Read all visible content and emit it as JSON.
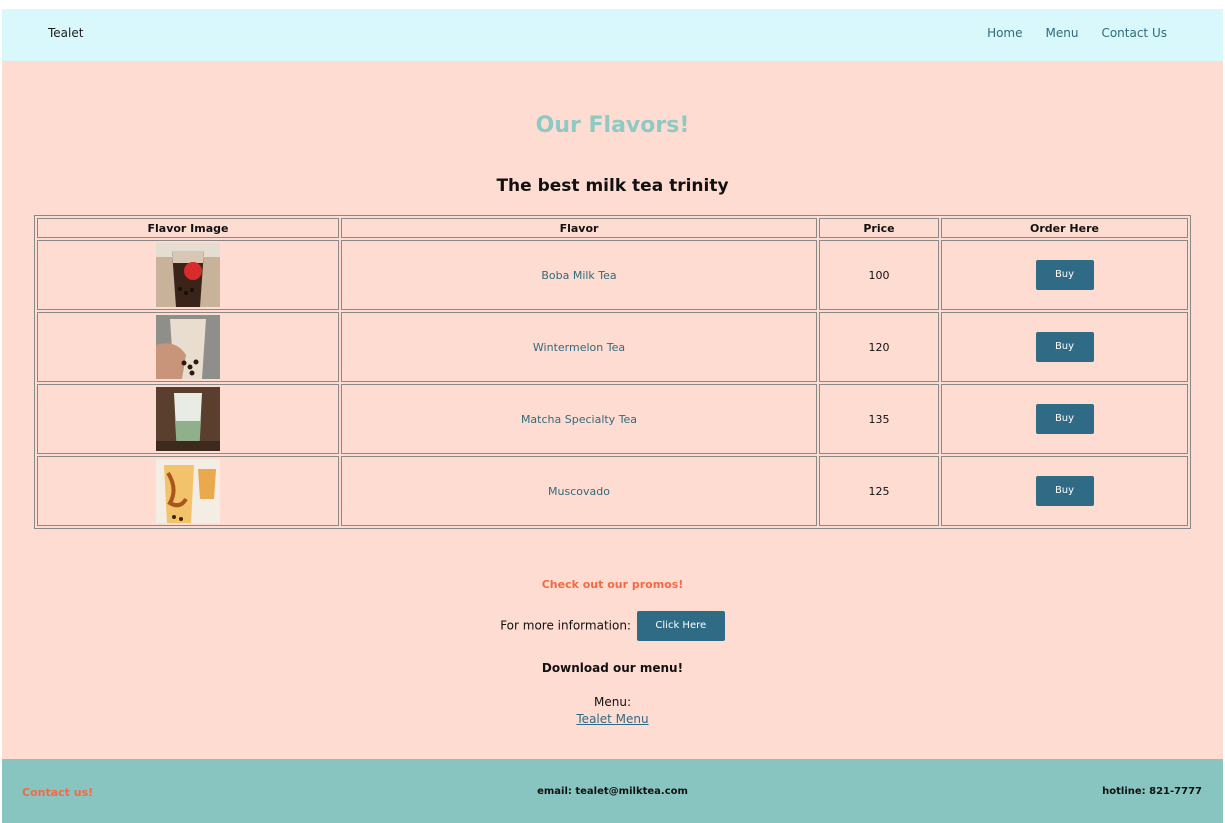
{
  "nav": {
    "brand": "Tealet",
    "links": [
      "Home",
      "Menu",
      "Contact Us"
    ]
  },
  "page": {
    "title": "Our Flavors!",
    "subtitle": "The best milk tea trinity"
  },
  "table": {
    "headers": [
      "Flavor Image",
      "Flavor",
      "Price",
      "Order Here"
    ],
    "rows": [
      {
        "flavor": "Boba Milk Tea",
        "price": "100",
        "buy": "Buy"
      },
      {
        "flavor": "Wintermelon Tea",
        "price": "120",
        "buy": "Buy"
      },
      {
        "flavor": "Matcha Specialty Tea",
        "price": "135",
        "buy": "Buy"
      },
      {
        "flavor": "Muscovado",
        "price": "125",
        "buy": "Buy"
      }
    ]
  },
  "promo": {
    "heading": "Check out our promos!",
    "info_text": "For more information:",
    "button": "Click Here"
  },
  "download": {
    "heading": "Download our menu!",
    "label": "Menu:",
    "link": "Tealet Menu"
  },
  "footer": {
    "contact": "Contact us!",
    "email": "email: tealet@milktea.com",
    "hotline": "hotline: 821-7777"
  },
  "colors": {
    "page_bg": "#ffdcd2",
    "nav_bg": "#d9f8fb",
    "footer_bg": "#88c4c0",
    "accent_teal": "#8ec9c4",
    "button": "#2f6b84",
    "promo_orange": "#f26a44"
  }
}
